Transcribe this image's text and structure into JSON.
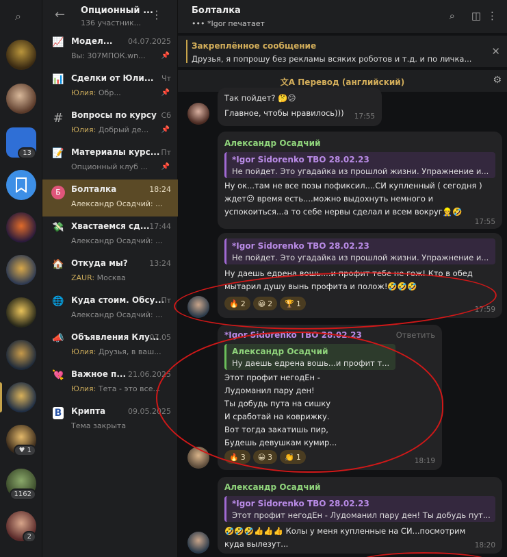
{
  "rail": {
    "badges": [
      "13",
      "1",
      "1162",
      "2"
    ]
  },
  "list_header": {
    "title": "Опционный ...",
    "subtitle": "136 участник..."
  },
  "chats": [
    {
      "icon": "📈",
      "name": "Модел...",
      "date": "04.07.2025",
      "preview": "Вы: 307МПОК.wn...",
      "sender": "",
      "pinned": true
    },
    {
      "icon": "📊",
      "name": "Сделки от Юли...",
      "date": "Чт",
      "preview": "Обр...",
      "sender": "Юлия:",
      "pinned": true
    },
    {
      "icon": "#",
      "name": "Вопросы по курсу",
      "date": "Сб",
      "preview": "Добрый де...",
      "sender": "Юлия:",
      "pinned": true
    },
    {
      "icon": "📝",
      "name": "Материалы курс...",
      "date": "Пт",
      "preview": "Опционный клуб ...",
      "sender": "",
      "pinned": true
    },
    {
      "icon": "Б",
      "name": "Болталка",
      "date": "18:24",
      "preview": "Александр Осадчий: ...",
      "sender": "",
      "pinned": false
    },
    {
      "icon": "💸",
      "name": "Хвастаемся сд...",
      "date": "17:44",
      "preview": "Александр Осадчий: ...",
      "sender": "",
      "pinned": false
    },
    {
      "icon": "🏠",
      "name": "Откуда мы?",
      "date": "13:24",
      "preview": "Москва",
      "sender": "ZAUR:",
      "pinned": false
    },
    {
      "icon": "🌐",
      "name": "Куда стоим. Обсу...",
      "date": "Пт",
      "preview": "Александр Осадчий: ...",
      "sender": "",
      "pinned": false
    },
    {
      "icon": "📣",
      "name": "Объявления Клу...",
      "date": "07.05",
      "preview": "Друзья, в ваш...",
      "sender": "Юлия:",
      "pinned": false
    },
    {
      "icon": "💘",
      "name": "Важное п...",
      "date": "21.06.2025",
      "preview": "Тета - это все...",
      "sender": "Юлия:",
      "pinned": false
    },
    {
      "icon": "B",
      "name": "Крипта",
      "date": "09.05.2025",
      "preview": "Тема закрыта",
      "sender": "",
      "pinned": false
    }
  ],
  "chat_header": {
    "title": "Болталка",
    "typing": "••• *Igor печатает"
  },
  "pinned": {
    "label": "Закреплённое сообщение",
    "text": "Друзья, я попрошу без рекламы всяких роботов и т.д. и по личка..."
  },
  "translate": {
    "label": "Перевод (английский)"
  },
  "messages": [
    {
      "reply_snippet": "Так пойдет? 🤔😕",
      "text": "Главное, чтобы нравилось)))",
      "time": "17:55"
    },
    {
      "author": "Александр Осадчий",
      "reply_author": "*Igor Sidorenko ТВО 28.02.23",
      "reply_text": "Не пойдет. Это угадайка из прошлой жизни. Упражнение и...",
      "lines": [
        "Ну ок...там не все позы пофиксил....СИ купленный ( сегодня )",
        "ждет😕 время есть....можно выдохнуть немного и",
        "успокоиться...а то себе нервы сделал и всем вокруг👷🤣"
      ],
      "time": "17:55"
    },
    {
      "reply_author": "*Igor Sidorenko ТВО 28.02.23",
      "reply_text": "Не пойдет. Это угадайка из прошлой жизни. Упражнение и...",
      "lines": [
        "Ну даешь едрена вошь....и профит тебе не гож! Кто в обед",
        "мытарил душу вынь профита и полож!🤣🤣🤣"
      ],
      "reactions": [
        {
          "emoji": "🔥",
          "count": "2"
        },
        {
          "emoji": "😀",
          "count": "2"
        },
        {
          "emoji": "🏆",
          "count": "1"
        }
      ],
      "time": "17:59"
    },
    {
      "author": "*Igor Sidorenko ТВО 28.02.23",
      "reply_button": "Ответить",
      "reply_author": "Александр Осадчий",
      "reply_text": "Ну даешь едрена вошь...и профит т...",
      "lines": [
        "Этот профит негодЕн -",
        "Лудоманил пару ден!",
        "Ты добудь пута на сишку",
        "И сработай на коврижку.",
        "Вот тогда закатишь пир,",
        "Будешь девушкам кумир..."
      ],
      "reactions": [
        {
          "emoji": "🔥",
          "count": "3"
        },
        {
          "emoji": "😀",
          "count": "3"
        },
        {
          "emoji": "👏",
          "count": "1"
        }
      ],
      "time": "18:19"
    },
    {
      "author": "Александр Осадчий",
      "reply_author": "*Igor Sidorenko ТВО 28.02.23",
      "reply_text": "Этот профит негодЕн -  Лудоманил пару ден! Ты добудь пут...",
      "lines": [
        "🤣🤣🤣👍👍👍  Колы у меня купленные на СИ...посмотрим",
        "куда вылезут..."
      ],
      "time": "18:20"
    }
  ],
  "colors": {
    "accent": "#c7a44b",
    "author_green": "#8fd37b",
    "author_purple": "#b98be6",
    "annotation_red": "#d01818"
  }
}
